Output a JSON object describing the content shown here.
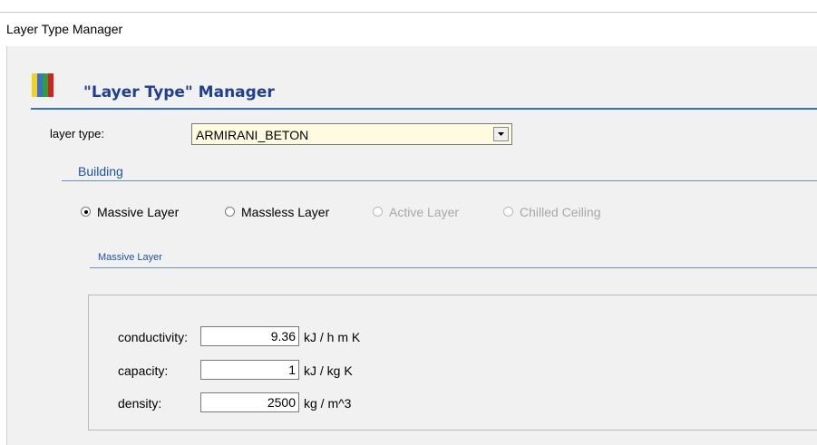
{
  "window": {
    "title": "Layer Type Manager"
  },
  "header": {
    "title": "\"Layer Type\" Manager",
    "logo_colors": [
      "#f2d21b",
      "#3b6fd6",
      "#27a33a",
      "#d62020"
    ]
  },
  "layer_type": {
    "label": "layer type:",
    "value": "ARMIRANI_BETON"
  },
  "building": {
    "section_title": "Building",
    "options": [
      {
        "label": "Massive Layer",
        "selected": true,
        "enabled": true
      },
      {
        "label": "Massless Layer",
        "selected": false,
        "enabled": true
      },
      {
        "label": "Active Layer",
        "selected": false,
        "enabled": false
      },
      {
        "label": "Chilled Ceiling",
        "selected": false,
        "enabled": false
      }
    ]
  },
  "massive_layer": {
    "section_title": "Massive Layer",
    "fields": [
      {
        "label": "conductivity:",
        "value": "9.36",
        "unit": "kJ / h m K"
      },
      {
        "label": "capacity:",
        "value": "1",
        "unit": "kJ / kg K"
      },
      {
        "label": "density:",
        "value": "2500",
        "unit": "kg / m^3"
      }
    ]
  },
  "colors": {
    "accent": "#1f3f8f",
    "section": "#2050a8",
    "combo_bg": "#fffbe0"
  }
}
